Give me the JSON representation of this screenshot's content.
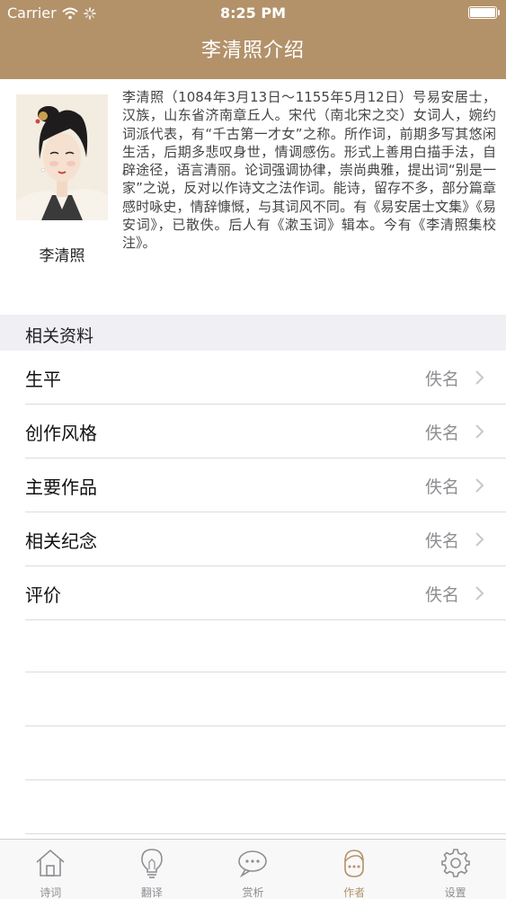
{
  "status_bar": {
    "carrier": "Carrier",
    "time": "8:25 PM"
  },
  "nav": {
    "title": "李清照介绍"
  },
  "author": {
    "name": "李清照",
    "bio": "李清照（1084年3月13日～1155年5月12日）号易安居士，汉族，山东省济南章丘人。宋代（南北宋之交）女词人，婉约词派代表，有“千古第一才女”之称。所作词，前期多写其悠闲生活，后期多悲叹身世，情调感伤。形式上善用白描手法，自辟途径，语言清丽。论词强调协律，崇尚典雅，提出词“别是一家”之说，反对以作诗文之法作词。能诗，留存不多，部分篇章感时咏史，情辞慷慨，与其词风不同。有《易安居士文集》《易安词》，已散佚。后人有《漱玉词》辑本。今有《李清照集校注》。"
  },
  "section": {
    "title": "相关资料"
  },
  "rows": [
    {
      "label": "生平",
      "value": "佚名"
    },
    {
      "label": "创作风格",
      "value": "佚名"
    },
    {
      "label": "主要作品",
      "value": "佚名"
    },
    {
      "label": "相关纪念",
      "value": "佚名"
    },
    {
      "label": "评价",
      "value": "佚名"
    }
  ],
  "tabs": [
    {
      "label": "诗词",
      "icon": "house-icon",
      "active": false
    },
    {
      "label": "翻译",
      "icon": "lightbulb-icon",
      "active": false
    },
    {
      "label": "赏析",
      "icon": "speech-bubble-icon",
      "active": false
    },
    {
      "label": "作者",
      "icon": "person-face-icon",
      "active": true
    },
    {
      "label": "设置",
      "icon": "gear-icon",
      "active": false
    }
  ],
  "colors": {
    "brand": "#b3926a",
    "separator": "#dcdcdc",
    "section_bg": "#efeff4",
    "secondary_text": "#8e8e93"
  }
}
